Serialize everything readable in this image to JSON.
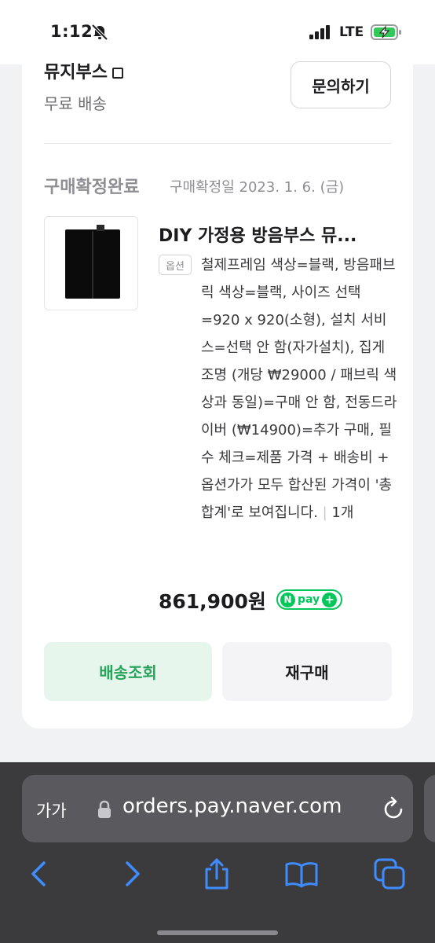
{
  "status_bar": {
    "time": "1:12",
    "network": "LTE"
  },
  "order": {
    "store_name": "뮤지부스",
    "shipping_label": "무료 배송",
    "inquiry_button": "문의하기",
    "status": "구매확정완료",
    "confirm_date": "구매확정일 2023. 1. 6. (금)",
    "product": {
      "title": "DIY 가정용 방음부스 뮤...",
      "option_badge": "옵션",
      "option_text": "철제프레임 색상=블랙, 방음패브릭 색상=블랙, 사이즈 선택=920 x 920(소형), 설치 서비스=선택 안 함(자가설치), 집게조명 (개당 ₩29000 / 패브릭 색상과 동일)=구매 안 함, 전동드라이버 (₩14900)=추가 구매, 필수 체크=제품 가격 + 배송비 + 옵션가가 모두 합산된 가격이 '총 합계'로 보여집니다.",
      "quantity": "1개",
      "price": "861,900원"
    },
    "npay": {
      "n": "N",
      "word": "pay",
      "plus": "+"
    },
    "buttons": {
      "ship_track": "배송조회",
      "rebuy": "재구매"
    }
  },
  "browser": {
    "text_size": "가가",
    "url": "orders.pay.naver.com",
    "icons": [
      "back-icon",
      "forward-icon",
      "share-icon",
      "bookmarks-icon",
      "tabs-icon"
    ]
  },
  "colors": {
    "accent_green": "#27a35a",
    "npay_green": "#03c75a",
    "safari_dark": "#3b3b3d",
    "safari_blue": "#3f8cff"
  }
}
